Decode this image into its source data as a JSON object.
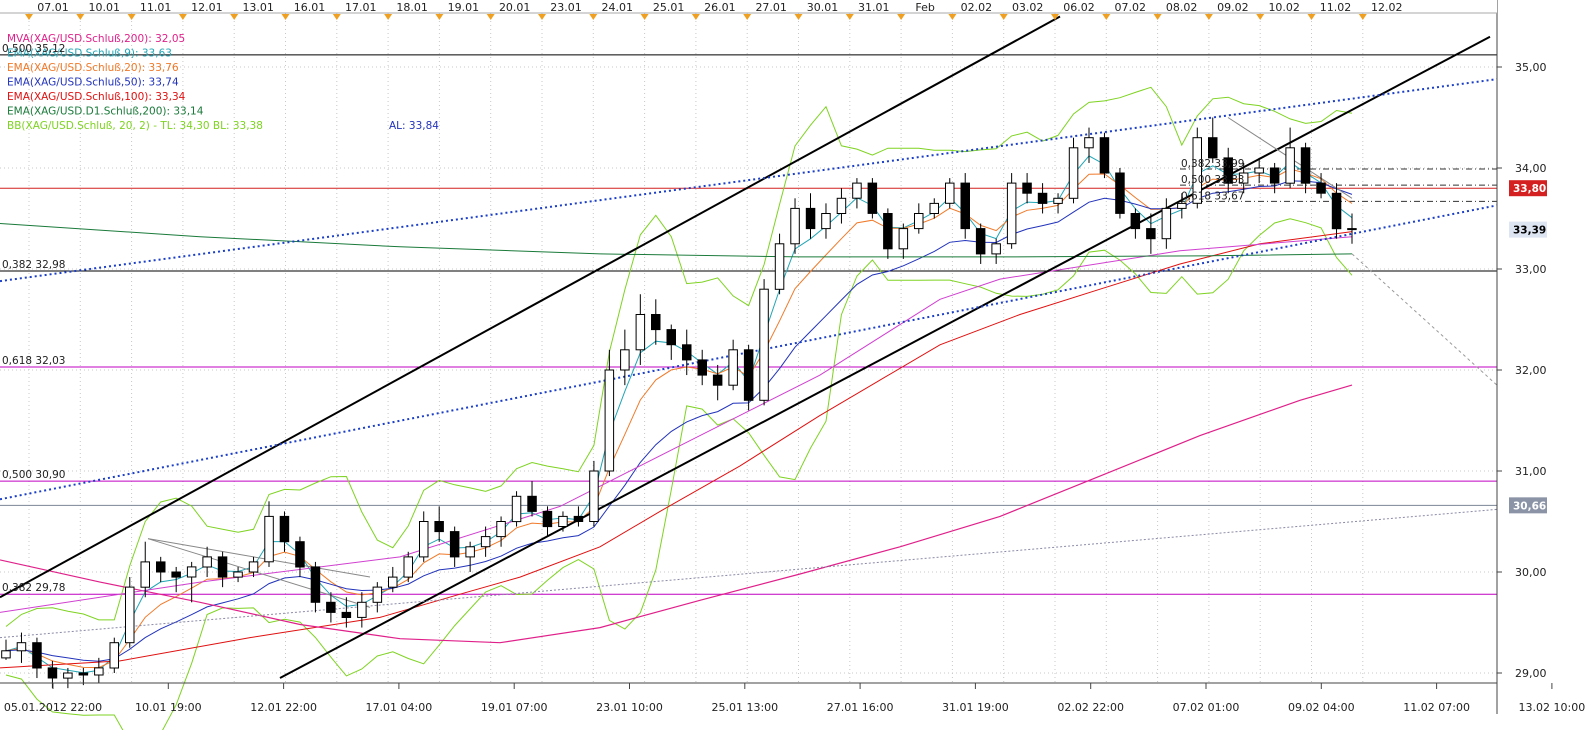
{
  "chart_data": {
    "type": "candlestick",
    "instrument": "XAG/USD",
    "ylim": [
      28.85,
      35.5
    ],
    "y_ticks": [
      "29,00",
      "30,00",
      "31,00",
      "32,00",
      "33,00",
      "34,00",
      "35,00"
    ],
    "top_dates": [
      "07.01",
      "10.01",
      "11.01",
      "12.01",
      "13.01",
      "16.01",
      "17.01",
      "18.01",
      "19.01",
      "20.01",
      "23.01",
      "24.01",
      "25.01",
      "26.01",
      "27.01",
      "30.01",
      "31.01",
      "Feb",
      "02.02",
      "03.02",
      "06.02",
      "07.02",
      "08.02",
      "09.02",
      "10.02",
      "11.02",
      "12.02"
    ],
    "bottom_dates": [
      "05.01.2012 22:00",
      "10.01 19:00",
      "12.01 22:00",
      "17.01 04:00",
      "19.01 07:00",
      "23.01 10:00",
      "25.01 13:00",
      "27.01 16:00",
      "31.01 19:00",
      "02.02 22:00",
      "07.02 01:00",
      "09.02 04:00",
      "11.02 07:00",
      "13.02 10:00"
    ],
    "legend": [
      {
        "text": "MVA(XAG/USD.Schluß,200): 32,05",
        "color": "#e0208a"
      },
      {
        "text": "EMA(XAG/USD.Schluß,9): 33,63",
        "color": "#21a5b5"
      },
      {
        "text": "EMA(XAG/USD.Schluß,20): 33,76",
        "color": "#f07a2a"
      },
      {
        "text": "EMA(XAG/USD.Schluß,50): 33,74",
        "color": "#2233bb"
      },
      {
        "text": "EMA(XAG/USD.Schluß,100): 33,34",
        "color": "#e01010"
      },
      {
        "text": "EMA(XAG/USD.D1.Schluß,200): 33,14",
        "color": "#1a7a3a"
      },
      {
        "text": "BB(XAG/USD.Schluß, 20, 2) -  TL: 34,30   BL: 33,38",
        "color": "#7ed321"
      },
      {
        "text": "AL: 33,84",
        "color": "#2233bb"
      }
    ],
    "fib_labels": [
      {
        "text": "0,500 35,12",
        "value": 35.12,
        "color": "#000000"
      },
      {
        "text": "0,382 32,98",
        "value": 32.98,
        "color": "#000000"
      },
      {
        "text": "0,618 32,03",
        "value": 32.03,
        "color": "#c000c0"
      },
      {
        "text": "0,500 30,90",
        "value": 30.9,
        "color": "#c000c0"
      },
      {
        "text": "0,382 29,78",
        "value": 29.78,
        "color": "#c000c0"
      }
    ],
    "fib_small": [
      {
        "text": "0,382 33,99",
        "value": 33.99
      },
      {
        "text": "0,500 33,83",
        "value": 33.83
      },
      {
        "text": "0,618 33,67",
        "value": 33.67
      }
    ],
    "price_badges": [
      {
        "text": "33,80",
        "value": 33.8,
        "bg": "#d42020",
        "fg": "#ffffff"
      },
      {
        "text": "33,39",
        "value": 33.39,
        "bg": "#dde4f2",
        "fg": "#000000"
      },
      {
        "text": "30,66",
        "value": 30.66,
        "bg": "#8a94a6",
        "fg": "#ffffff"
      }
    ],
    "candles": [
      [
        29.15,
        29.33,
        29.13,
        29.22
      ],
      [
        29.22,
        29.4,
        29.1,
        29.3
      ],
      [
        29.3,
        29.35,
        28.95,
        29.05
      ],
      [
        29.05,
        29.12,
        28.85,
        28.95
      ],
      [
        28.95,
        29.05,
        28.85,
        29.0
      ],
      [
        29.0,
        29.05,
        28.88,
        28.98
      ],
      [
        28.98,
        29.15,
        28.9,
        29.05
      ],
      [
        29.05,
        29.35,
        29.0,
        29.3
      ],
      [
        29.3,
        29.95,
        29.25,
        29.85
      ],
      [
        29.85,
        30.3,
        29.75,
        30.1
      ],
      [
        30.1,
        30.15,
        29.9,
        30.0
      ],
      [
        30.0,
        30.05,
        29.8,
        29.95
      ],
      [
        29.95,
        30.1,
        29.7,
        30.05
      ],
      [
        30.05,
        30.25,
        29.95,
        30.15
      ],
      [
        30.15,
        30.2,
        29.85,
        29.95
      ],
      [
        29.95,
        30.05,
        29.9,
        30.0
      ],
      [
        30.0,
        30.15,
        29.95,
        30.1
      ],
      [
        30.1,
        30.7,
        30.05,
        30.55
      ],
      [
        30.55,
        30.6,
        30.2,
        30.3
      ],
      [
        30.3,
        30.35,
        29.95,
        30.05
      ],
      [
        30.05,
        30.1,
        29.6,
        29.7
      ],
      [
        29.7,
        29.8,
        29.5,
        29.6
      ],
      [
        29.6,
        29.75,
        29.45,
        29.55
      ],
      [
        29.55,
        29.8,
        29.45,
        29.7
      ],
      [
        29.7,
        29.9,
        29.6,
        29.85
      ],
      [
        29.85,
        30.05,
        29.8,
        29.95
      ],
      [
        29.95,
        30.2,
        29.9,
        30.15
      ],
      [
        30.15,
        30.6,
        30.1,
        30.5
      ],
      [
        30.5,
        30.65,
        30.3,
        30.4
      ],
      [
        30.4,
        30.45,
        30.05,
        30.15
      ],
      [
        30.15,
        30.3,
        30.0,
        30.25
      ],
      [
        30.25,
        30.45,
        30.15,
        30.35
      ],
      [
        30.35,
        30.55,
        30.25,
        30.5
      ],
      [
        30.5,
        30.8,
        30.45,
        30.75
      ],
      [
        30.75,
        30.9,
        30.55,
        30.6
      ],
      [
        30.6,
        30.65,
        30.35,
        30.45
      ],
      [
        30.45,
        30.6,
        30.4,
        30.55
      ],
      [
        30.55,
        30.65,
        30.45,
        30.5
      ],
      [
        30.5,
        31.1,
        30.45,
        31.0
      ],
      [
        31.0,
        32.2,
        30.95,
        32.0
      ],
      [
        32.0,
        32.4,
        31.85,
        32.2
      ],
      [
        32.2,
        32.75,
        32.05,
        32.55
      ],
      [
        32.55,
        32.7,
        32.25,
        32.4
      ],
      [
        32.4,
        32.45,
        32.1,
        32.25
      ],
      [
        32.25,
        32.4,
        31.95,
        32.1
      ],
      [
        32.1,
        32.2,
        31.85,
        31.95
      ],
      [
        31.95,
        32.05,
        31.7,
        31.85
      ],
      [
        31.85,
        32.3,
        31.8,
        32.2
      ],
      [
        32.2,
        32.25,
        31.6,
        31.7
      ],
      [
        31.7,
        32.9,
        31.65,
        32.8
      ],
      [
        32.8,
        33.35,
        32.75,
        33.25
      ],
      [
        33.25,
        33.7,
        33.15,
        33.6
      ],
      [
        33.6,
        33.75,
        33.3,
        33.4
      ],
      [
        33.4,
        33.65,
        33.3,
        33.55
      ],
      [
        33.55,
        33.8,
        33.45,
        33.7
      ],
      [
        33.7,
        33.9,
        33.6,
        33.85
      ],
      [
        33.85,
        33.9,
        33.5,
        33.55
      ],
      [
        33.55,
        33.6,
        33.1,
        33.2
      ],
      [
        33.2,
        33.45,
        33.1,
        33.4
      ],
      [
        33.4,
        33.65,
        33.35,
        33.55
      ],
      [
        33.55,
        33.7,
        33.5,
        33.65
      ],
      [
        33.65,
        33.9,
        33.6,
        33.85
      ],
      [
        33.85,
        33.95,
        33.3,
        33.4
      ],
      [
        33.4,
        33.45,
        33.05,
        33.15
      ],
      [
        33.15,
        33.3,
        33.05,
        33.25
      ],
      [
        33.25,
        33.95,
        33.2,
        33.85
      ],
      [
        33.85,
        33.95,
        33.65,
        33.75
      ],
      [
        33.75,
        33.85,
        33.55,
        33.65
      ],
      [
        33.65,
        33.75,
        33.55,
        33.7
      ],
      [
        33.7,
        34.3,
        33.65,
        34.2
      ],
      [
        34.2,
        34.4,
        34.05,
        34.3
      ],
      [
        34.3,
        34.35,
        33.9,
        33.95
      ],
      [
        33.95,
        34.0,
        33.5,
        33.55
      ],
      [
        33.55,
        33.6,
        33.3,
        33.4
      ],
      [
        33.4,
        33.55,
        33.15,
        33.3
      ],
      [
        33.3,
        33.7,
        33.2,
        33.6
      ],
      [
        33.6,
        33.75,
        33.5,
        33.65
      ],
      [
        33.65,
        34.4,
        33.6,
        34.3
      ],
      [
        34.3,
        34.5,
        34.05,
        34.1
      ],
      [
        34.1,
        34.2,
        33.75,
        33.85
      ],
      [
        33.85,
        34.05,
        33.75,
        33.95
      ],
      [
        33.95,
        34.1,
        33.85,
        34.0
      ],
      [
        34.0,
        34.05,
        33.75,
        33.85
      ],
      [
        33.85,
        34.4,
        33.8,
        34.2
      ],
      [
        34.2,
        34.25,
        33.75,
        33.85
      ],
      [
        33.85,
        33.95,
        33.7,
        33.75
      ],
      [
        33.75,
        33.85,
        33.3,
        33.4
      ],
      [
        33.4,
        33.55,
        33.25,
        33.39
      ]
    ]
  }
}
